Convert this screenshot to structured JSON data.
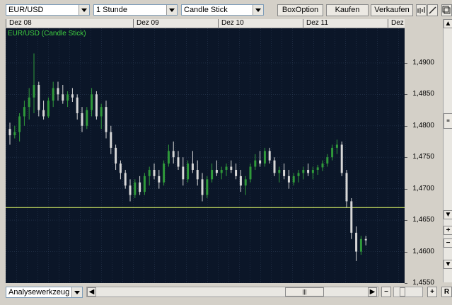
{
  "toolbar": {
    "symbol": "EUR/USD",
    "interval": "1 Stunde",
    "chart_type": "Candle Stick",
    "box_option": "BoxOption",
    "buy": "Kaufen",
    "sell": "Verkaufen"
  },
  "time_axis": [
    "Dez 08",
    "Dez 09",
    "Dez 10",
    "Dez 11",
    "Dez"
  ],
  "price_axis": [
    "1,4900",
    "1,4850",
    "1,4800",
    "1,4750",
    "1,4700",
    "1,4650",
    "1,4600",
    "1,4550"
  ],
  "chart_title": "EUR/USD (Candle Stick)",
  "bottom": {
    "tool_select": "Analysewerkzeug",
    "scroll_grip": "|||",
    "zoom_out": "−",
    "zoom_in": "+",
    "reset": "R",
    "side_plus": "+",
    "side_minus": "−"
  },
  "colors": {
    "background": "#0b1628",
    "grid": "#2a3a52",
    "up_candle": "#2f9a3a",
    "down_candle": "#d8d8d8",
    "reference_line": "#c8e060",
    "title": "#3fd040"
  },
  "chart_data": {
    "type": "candlestick",
    "title": "EUR/USD (Candle Stick)",
    "ylim": [
      1.455,
      1.4955
    ],
    "reference_line": 1.467,
    "candles": [
      [
        1.4795,
        1.4805,
        1.477,
        1.4785
      ],
      [
        1.4785,
        1.48,
        1.478,
        1.479
      ],
      [
        1.479,
        1.482,
        1.4775,
        1.4815
      ],
      [
        1.4815,
        1.484,
        1.48,
        1.483
      ],
      [
        1.483,
        1.486,
        1.481,
        1.4845
      ],
      [
        1.4845,
        1.4915,
        1.482,
        1.4865
      ],
      [
        1.4865,
        1.487,
        1.4815,
        1.4825
      ],
      [
        1.4825,
        1.484,
        1.481,
        1.4815
      ],
      [
        1.4815,
        1.4845,
        1.4812,
        1.484
      ],
      [
        1.484,
        1.487,
        1.483,
        1.486
      ],
      [
        1.486,
        1.487,
        1.484,
        1.485
      ],
      [
        1.485,
        1.4865,
        1.4835,
        1.484
      ],
      [
        1.484,
        1.4855,
        1.483,
        1.485
      ],
      [
        1.485,
        1.486,
        1.4838,
        1.4845
      ],
      [
        1.4845,
        1.485,
        1.481,
        1.482
      ],
      [
        1.482,
        1.483,
        1.479,
        1.48
      ],
      [
        1.48,
        1.483,
        1.4795,
        1.4825
      ],
      [
        1.4825,
        1.486,
        1.4815,
        1.485
      ],
      [
        1.485,
        1.4855,
        1.481,
        1.4815
      ],
      [
        1.4815,
        1.4835,
        1.4795,
        1.483
      ],
      [
        1.483,
        1.484,
        1.478,
        1.479
      ],
      [
        1.479,
        1.48,
        1.4755,
        1.4765
      ],
      [
        1.4765,
        1.477,
        1.473,
        1.474
      ],
      [
        1.474,
        1.4745,
        1.4715,
        1.4725
      ],
      [
        1.4725,
        1.473,
        1.47,
        1.4705
      ],
      [
        1.4705,
        1.4715,
        1.468,
        1.469
      ],
      [
        1.469,
        1.4715,
        1.4685,
        1.471
      ],
      [
        1.471,
        1.472,
        1.469,
        1.4695
      ],
      [
        1.4695,
        1.4725,
        1.469,
        1.472
      ],
      [
        1.472,
        1.4735,
        1.4705,
        1.473
      ],
      [
        1.473,
        1.474,
        1.4715,
        1.472
      ],
      [
        1.472,
        1.473,
        1.47,
        1.471
      ],
      [
        1.471,
        1.4745,
        1.4705,
        1.474
      ],
      [
        1.474,
        1.477,
        1.4735,
        1.476
      ],
      [
        1.476,
        1.4775,
        1.474,
        1.475
      ],
      [
        1.475,
        1.476,
        1.473,
        1.4735
      ],
      [
        1.4735,
        1.475,
        1.4705,
        1.4715
      ],
      [
        1.4715,
        1.4745,
        1.471,
        1.474
      ],
      [
        1.474,
        1.476,
        1.4725,
        1.473
      ],
      [
        1.473,
        1.4745,
        1.4705,
        1.4715
      ],
      [
        1.4715,
        1.4725,
        1.468,
        1.469
      ],
      [
        1.469,
        1.472,
        1.4685,
        1.4715
      ],
      [
        1.4715,
        1.474,
        1.471,
        1.473
      ],
      [
        1.473,
        1.4745,
        1.472,
        1.4725
      ],
      [
        1.4725,
        1.4735,
        1.4715,
        1.473
      ],
      [
        1.473,
        1.474,
        1.472,
        1.4735
      ],
      [
        1.4735,
        1.4745,
        1.4725,
        1.473
      ],
      [
        1.473,
        1.474,
        1.4715,
        1.472
      ],
      [
        1.472,
        1.473,
        1.4695,
        1.4705
      ],
      [
        1.4705,
        1.472,
        1.469,
        1.4715
      ],
      [
        1.4715,
        1.474,
        1.471,
        1.4735
      ],
      [
        1.4735,
        1.4755,
        1.473,
        1.4745
      ],
      [
        1.4745,
        1.476,
        1.4735,
        1.474
      ],
      [
        1.474,
        1.4765,
        1.4735,
        1.476
      ],
      [
        1.476,
        1.4765,
        1.474,
        1.4745
      ],
      [
        1.4745,
        1.475,
        1.472,
        1.4725
      ],
      [
        1.4725,
        1.4735,
        1.471,
        1.473
      ],
      [
        1.473,
        1.474,
        1.4715,
        1.472
      ],
      [
        1.472,
        1.473,
        1.47,
        1.471
      ],
      [
        1.471,
        1.4725,
        1.4705,
        1.472
      ],
      [
        1.472,
        1.473,
        1.471,
        1.4725
      ],
      [
        1.4725,
        1.4735,
        1.4715,
        1.473
      ],
      [
        1.473,
        1.474,
        1.472,
        1.4725
      ],
      [
        1.4725,
        1.4735,
        1.4715,
        1.473
      ],
      [
        1.473,
        1.4738,
        1.4722,
        1.4734
      ],
      [
        1.4734,
        1.4745,
        1.4728,
        1.474
      ],
      [
        1.474,
        1.4755,
        1.4735,
        1.475
      ],
      [
        1.475,
        1.477,
        1.4745,
        1.4765
      ],
      [
        1.4765,
        1.4778,
        1.4755,
        1.477
      ],
      [
        1.477,
        1.4775,
        1.472,
        1.4725
      ],
      [
        1.4725,
        1.473,
        1.467,
        1.468
      ],
      [
        1.468,
        1.4685,
        1.462,
        1.463
      ],
      [
        1.463,
        1.464,
        1.4585,
        1.46
      ],
      [
        1.46,
        1.4625,
        1.4595,
        1.462
      ],
      [
        1.462,
        1.4625,
        1.461,
        1.4618
      ]
    ]
  }
}
